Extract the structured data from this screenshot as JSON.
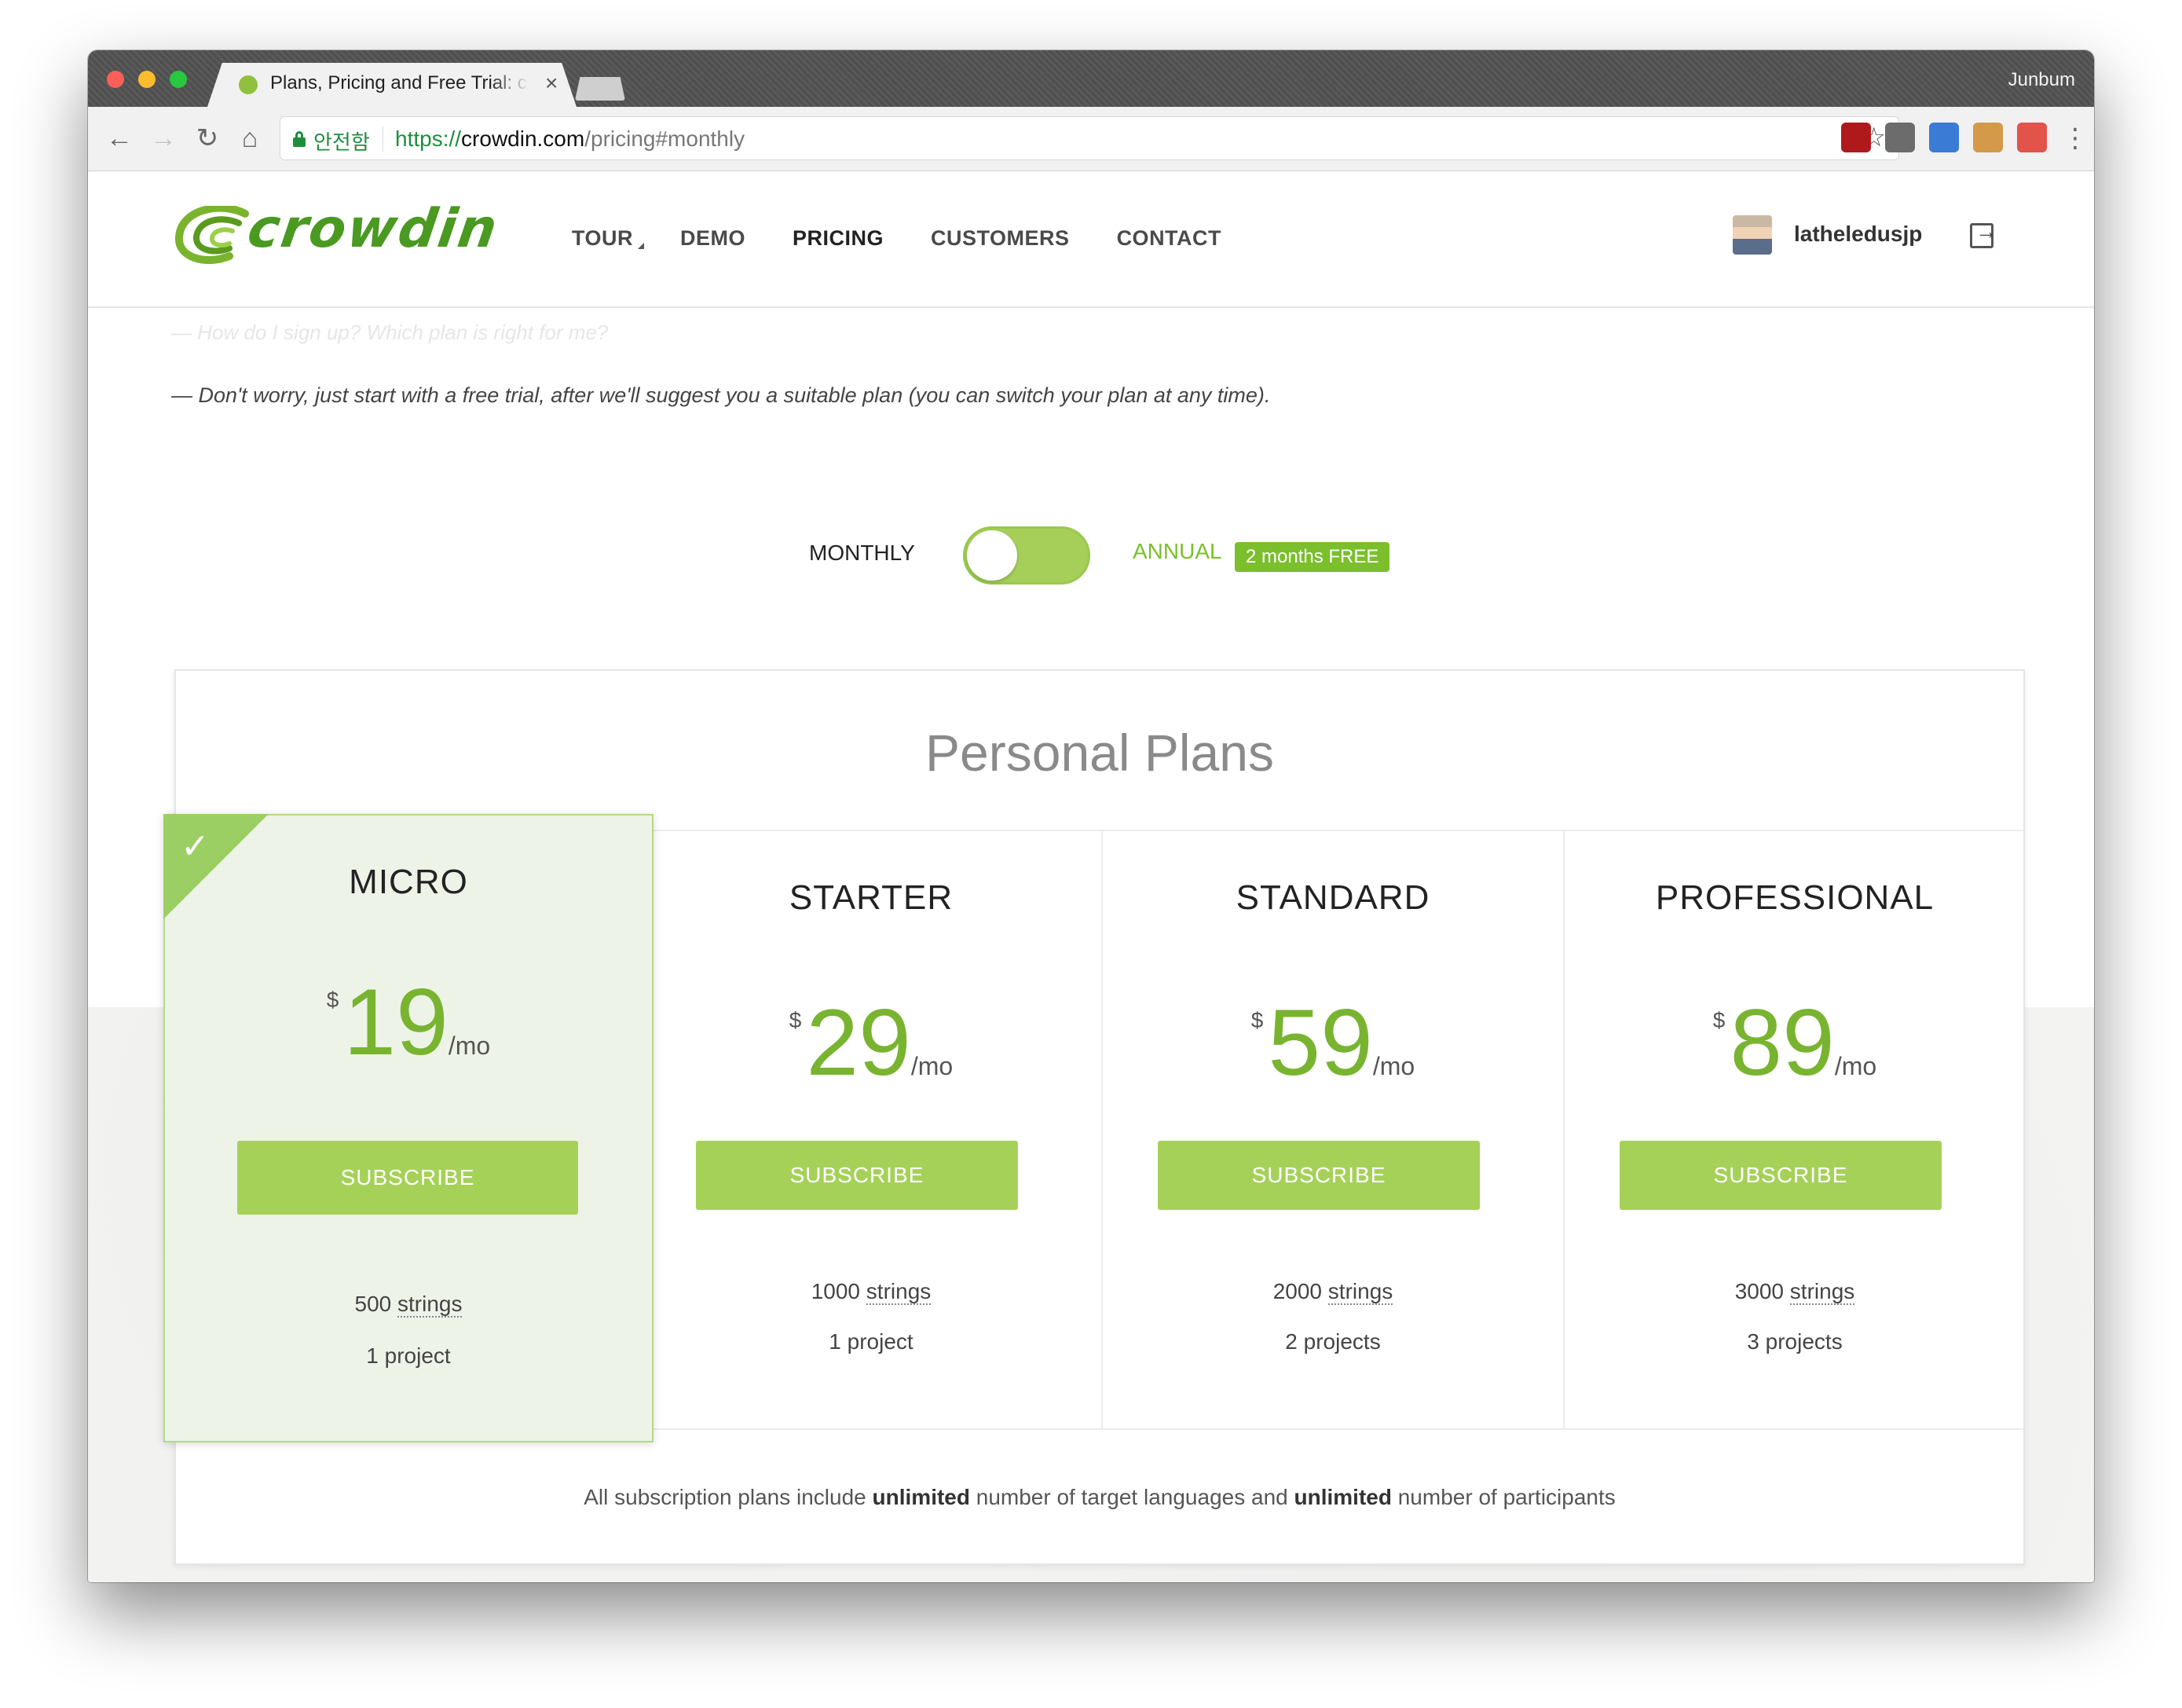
{
  "browser": {
    "tab_title": "Plans, Pricing and Free Trial: c",
    "tab_close": "×",
    "profile_name": "Junbum",
    "secure_label": "안전함",
    "url_scheme": "https://",
    "url_host": "crowdin.com",
    "url_path": "/pricing#monthly",
    "back_icon": "←",
    "forward_icon": "→",
    "reload_icon": "↻",
    "home_icon": "⌂",
    "star_icon": "☆",
    "menu_icon": "⋮",
    "extensions": [
      {
        "name": "ublock-extension-icon",
        "color": "#b0191b"
      },
      {
        "name": "lightbulb-extension-icon",
        "color": "#6c6c6c"
      },
      {
        "name": "globe-extension-icon",
        "color": "#3a7bd5"
      },
      {
        "name": "cookie-extension-icon",
        "color": "#d49a4a"
      },
      {
        "name": "pacman-extension-icon",
        "color": "#e2534a"
      }
    ]
  },
  "site": {
    "logo_text": "crowdin",
    "nav": [
      "TOUR",
      "DEMO",
      "PRICING",
      "CUSTOMERS",
      "CONTACT"
    ],
    "user_name": "latheledusjp"
  },
  "faq": {
    "question": "— How do I sign up? Which plan is right for me?",
    "answer": "— Don't worry, just start with a free trial, after we'll suggest you a suitable plan (you can switch your plan at any time)."
  },
  "billing": {
    "monthly": "MONTHLY",
    "annual": "ANNUAL",
    "badge": "2 months FREE",
    "selected": "monthly"
  },
  "plans_section": {
    "heading": "Personal Plans",
    "footer_pre": "All subscription plans include ",
    "footer_bold1": "unlimited",
    "footer_mid": " number of target languages and ",
    "footer_bold2": "unlimited",
    "footer_post": " number of participants"
  },
  "plans": [
    {
      "name": "MICRO",
      "currency": "$",
      "price": "19",
      "period": "/mo",
      "cta": "SUBSCRIBE",
      "strings_count": "500",
      "strings_word": "strings",
      "projects": "1 project",
      "featured": true
    },
    {
      "name": "STARTER",
      "currency": "$",
      "price": "29",
      "period": "/mo",
      "cta": "SUBSCRIBE",
      "strings_count": "1000",
      "strings_word": "strings",
      "projects": "1 project",
      "featured": false
    },
    {
      "name": "STANDARD",
      "currency": "$",
      "price": "59",
      "period": "/mo",
      "cta": "SUBSCRIBE",
      "strings_count": "2000",
      "strings_word": "strings",
      "projects": "2 projects",
      "featured": false
    },
    {
      "name": "PROFESSIONAL",
      "currency": "$",
      "price": "89",
      "period": "/mo",
      "cta": "SUBSCRIBE",
      "strings_count": "3000",
      "strings_word": "strings",
      "projects": "3 projects",
      "featured": false
    }
  ],
  "colors": {
    "brand_green": "#79b430",
    "button_green": "#a6d159",
    "featured_bg": "#eef3e8"
  }
}
